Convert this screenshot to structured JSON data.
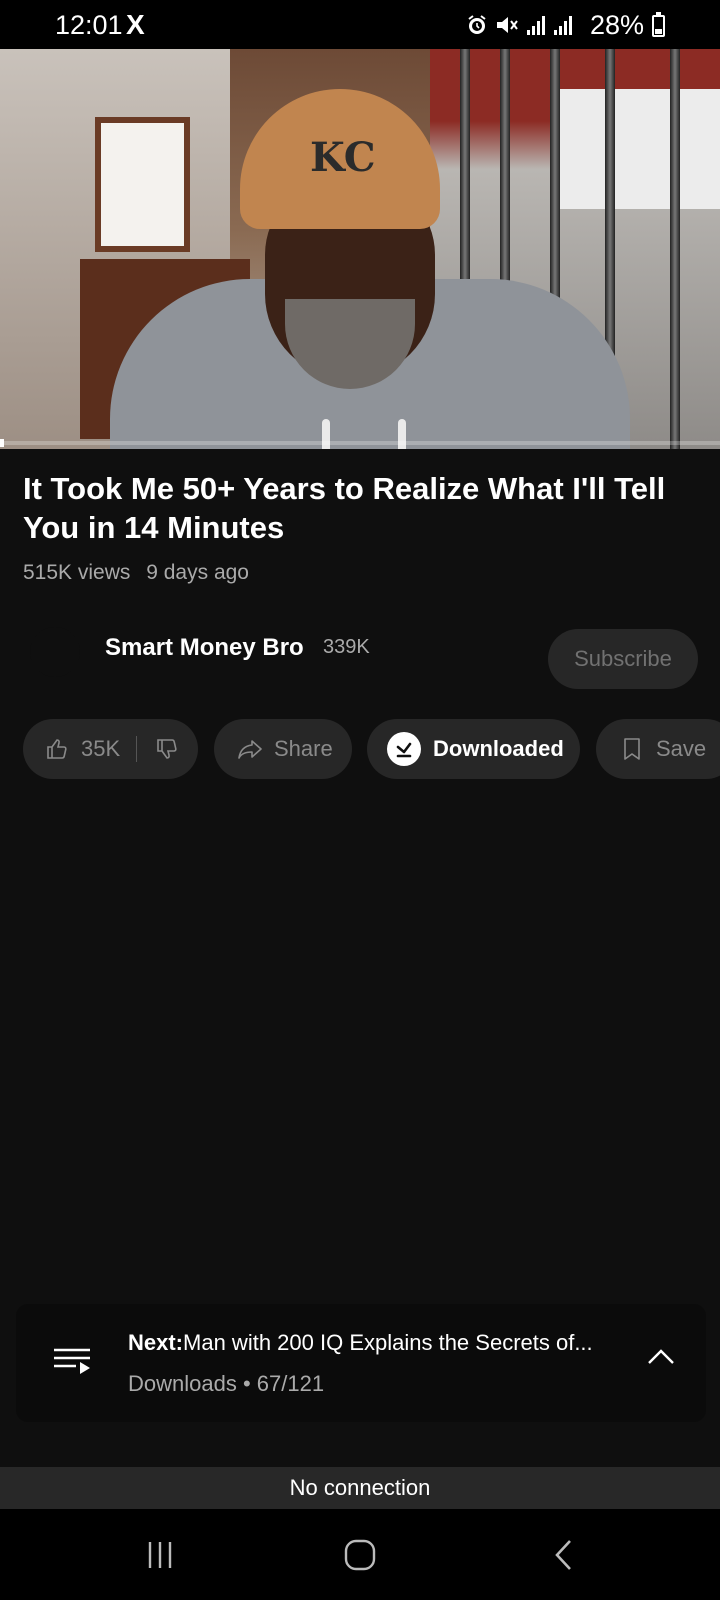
{
  "status_bar": {
    "time": "12:01",
    "app_icon": "X",
    "battery_percent": "28%",
    "battery_level": 0.28,
    "icons": [
      "alarm-icon",
      "mute-icon",
      "signal-icon",
      "signal-icon"
    ]
  },
  "video": {
    "cap_logo": "KC",
    "progress": 0.0
  },
  "info": {
    "title": "It Took Me 50+ Years to Realize What I'll Tell You in 14 Minutes",
    "views": "515K views",
    "age": "9 days ago"
  },
  "channel": {
    "name": "Smart Money Bro",
    "subscribers": "339K",
    "subscribe_label": "Subscribe"
  },
  "actions": {
    "like_count": "35K",
    "share_label": "Share",
    "download_label": "Downloaded",
    "save_label": "Save"
  },
  "next_up": {
    "prefix": "Next:",
    "title": "Man with 200 IQ Explains the Secrets of...",
    "playlist": "Downloads • 67/121"
  },
  "banner": {
    "no_connection": "No connection"
  },
  "colors": {
    "background": "#0f0f0f",
    "pill": "#272727",
    "muted_text": "#aaaaaa"
  }
}
